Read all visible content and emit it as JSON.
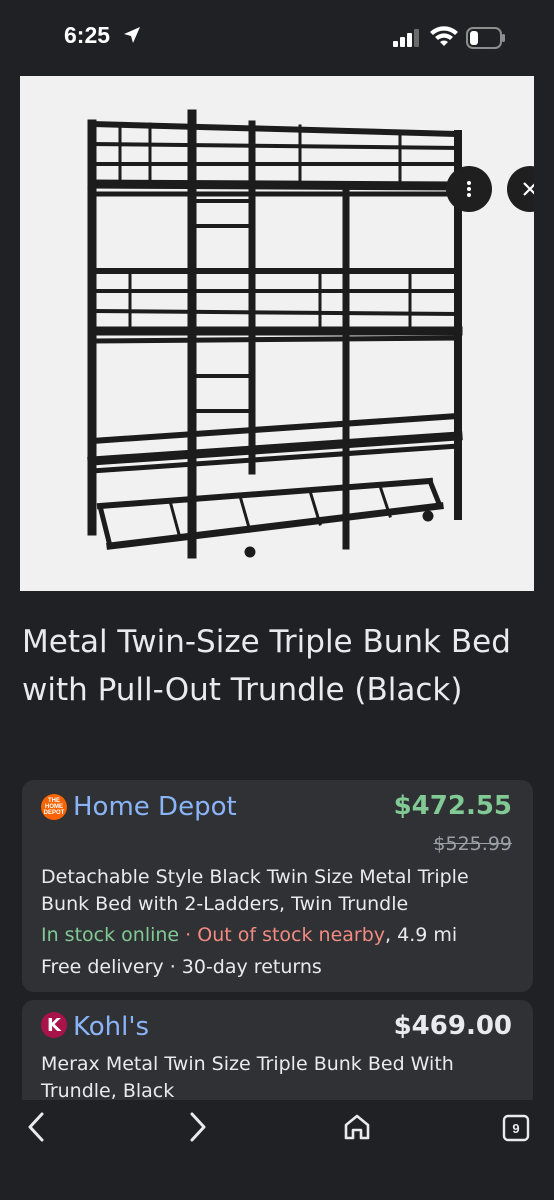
{
  "status_bar": {
    "time": "6:25"
  },
  "product": {
    "title": "Metal Twin-Size Triple Bunk Bed with Pull-Out Trundle (Black)",
    "image_icons": [
      "more-vert-icon",
      "close-icon"
    ]
  },
  "offers": [
    {
      "store": "Home Depot",
      "logo_text": "THE HOME DEPOT",
      "price": "$472.55",
      "old_price": "$525.99",
      "description": "Detachable Style Black Twin Size Metal Triple Bunk Bed with 2-Ladders, Twin Trundle",
      "in_stock": "In stock online",
      "separator": " · ",
      "out_of_stock": "Out of stock nearby",
      "distance": ", 4.9 mi",
      "delivery": "Free delivery · 30-day returns"
    },
    {
      "store": "Kohl's",
      "logo_text": "K",
      "price": "$469.00",
      "description": "Merax Metal Twin Size Triple Bunk Bed With Trundle, Black"
    }
  ],
  "bottom_nav": {
    "tab_count": "9"
  },
  "colors": {
    "background": "#202124",
    "card": "#303134",
    "link": "#8ab4f8",
    "price_green": "#81c995",
    "out_of_stock_red": "#f28b82"
  }
}
